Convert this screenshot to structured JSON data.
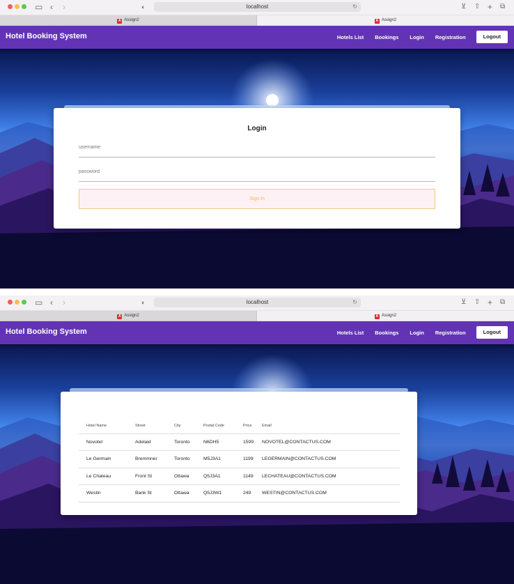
{
  "browser": {
    "url": "localhost",
    "tabs": [
      {
        "title": "Assign2"
      },
      {
        "title": "Assign2"
      }
    ]
  },
  "navbar": {
    "brand": "Hotel Booking System",
    "links": [
      "Hotels List",
      "Bookings",
      "Login",
      "Registration"
    ],
    "logout": "Logout"
  },
  "login": {
    "title": "Login",
    "username_placeholder": "username",
    "password_placeholder": "password",
    "signin_label": "Sign In"
  },
  "hotels": {
    "columns": [
      "Hotel Name",
      "Street",
      "City",
      "Postal Code",
      "Price",
      "Email"
    ],
    "rows": [
      [
        "Novotel",
        "Adelaid",
        "Toronto",
        "N6DH5",
        "1599",
        "NOVOTEL@CONTACTUS.COM"
      ],
      [
        "Le Germain",
        "Bremmner",
        "Toronto",
        "M5J3A1",
        "1199",
        "LEGERMAIN@CONTACTUS.COM"
      ],
      [
        "Le Chateau",
        "Front St",
        "Ottawa",
        "Q5J3A1",
        "1149",
        "LECHATEAU@CONTACTUS.COM"
      ],
      [
        "Westin",
        "Bank St",
        "Ottawa",
        "Q5J3W1",
        "249",
        "WESTIN@CONTACTUS.COM"
      ]
    ]
  },
  "colors": {
    "navbar": "#6234b5",
    "signin_border": "#f3c97a",
    "signin_text": "#f2b94a"
  }
}
